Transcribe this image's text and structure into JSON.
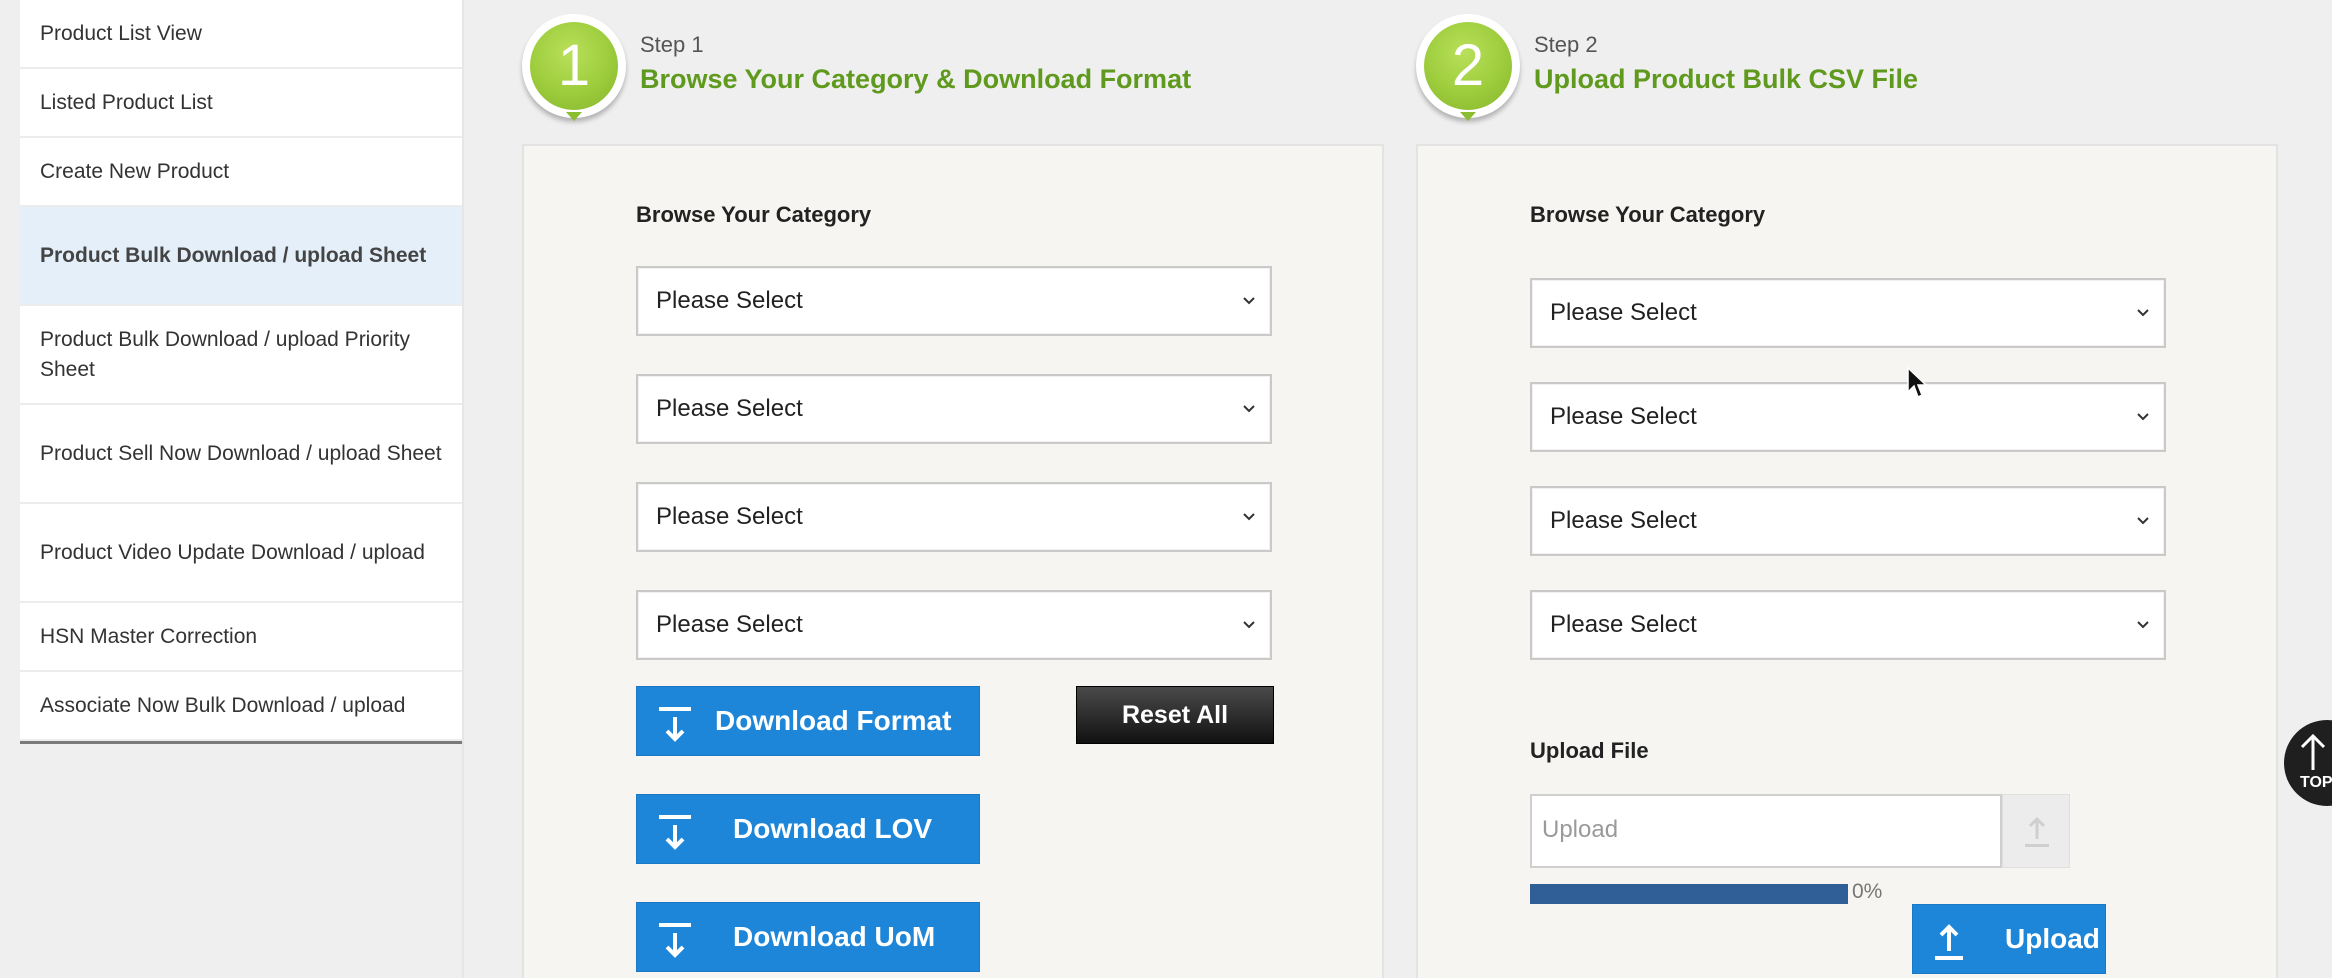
{
  "sidebar": {
    "items": [
      {
        "label": "Product List View",
        "active": false
      },
      {
        "label": "Listed Product List",
        "active": false
      },
      {
        "label": "Create New Product",
        "active": false
      },
      {
        "label": "Product Bulk Download / upload Sheet",
        "active": true
      },
      {
        "label": "Product Bulk Download / upload Priority Sheet",
        "active": false
      },
      {
        "label": "Product Sell Now Download / upload Sheet",
        "active": false
      },
      {
        "label": "Product Video Update Download / upload",
        "active": false
      },
      {
        "label": "HSN Master Correction",
        "active": false
      },
      {
        "label": "Associate Now Bulk Download / upload",
        "active": false
      }
    ]
  },
  "step1": {
    "number": "1",
    "label": "Step 1",
    "title": "Browse Your Category & Download Format",
    "panel_title": "Browse Your Category",
    "selects": [
      "Please Select",
      "Please Select",
      "Please Select",
      "Please Select"
    ],
    "buttons": {
      "download_format": "Download Format",
      "download_lov": "Download LOV",
      "download_uom": "Download UoM",
      "reset_all": "Reset All"
    }
  },
  "step2": {
    "number": "2",
    "label": "Step 2",
    "title": "Upload Product Bulk CSV File",
    "panel_title": "Browse Your Category",
    "selects": [
      "Please Select",
      "Please Select",
      "Please Select",
      "Please Select"
    ],
    "upload_file_label": "Upload File",
    "upload_placeholder": "Upload",
    "progress": 0,
    "progress_text": "0%",
    "upload_button": "Upload"
  },
  "to_top_label": "TOP",
  "colors": {
    "accent_green": "#5f9a1e",
    "button_blue": "#1e86d9",
    "active_item_bg": "#e4eff9",
    "progress_blue": "#2f5f96"
  }
}
